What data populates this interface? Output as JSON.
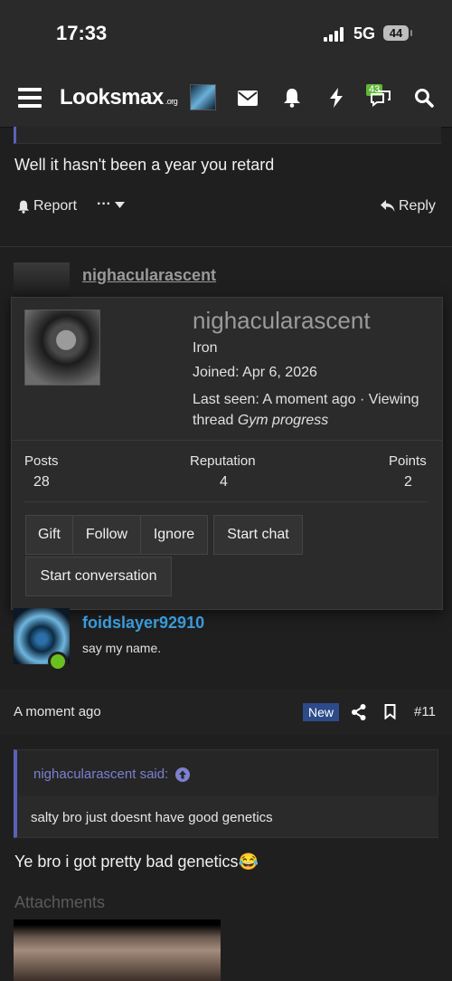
{
  "status": {
    "time": "17:33",
    "network": "5G",
    "battery": "44"
  },
  "nav": {
    "logo": "Looksmax",
    "logo_suffix": ".org",
    "alerts_badge": "43"
  },
  "post1": {
    "text": "Well it hasn't been a year you retard",
    "report_label": "Report",
    "more_label": "···",
    "reply_label": "Reply"
  },
  "post2": {
    "username": "nighacularascent"
  },
  "popup": {
    "username": "nighacularascent",
    "rank": "Iron",
    "joined": "Joined: Apr 6, 2026",
    "last_seen": "Last seen: A moment ago · Viewing thread",
    "thread": "Gym progress",
    "posts_label": "Posts",
    "posts_value": "28",
    "rep_label": "Reputation",
    "rep_value": "4",
    "points_label": "Points",
    "points_value": "2",
    "buttons": {
      "gift": "Gift",
      "follow": "Follow",
      "ignore": "Ignore",
      "start_chat": "Start chat",
      "start_conversation": "Start conversation"
    }
  },
  "post3": {
    "username": "foidslayer92910",
    "user_title": "say my name.",
    "time": "A moment ago",
    "new_badge": "New",
    "post_number": "#11",
    "quote_author": "nighacularascent said:",
    "quote_text": "salty bro just doesnt have good genetics",
    "text": "Ye bro i got pretty bad genetics😂",
    "attachments_label": "Attachments"
  }
}
